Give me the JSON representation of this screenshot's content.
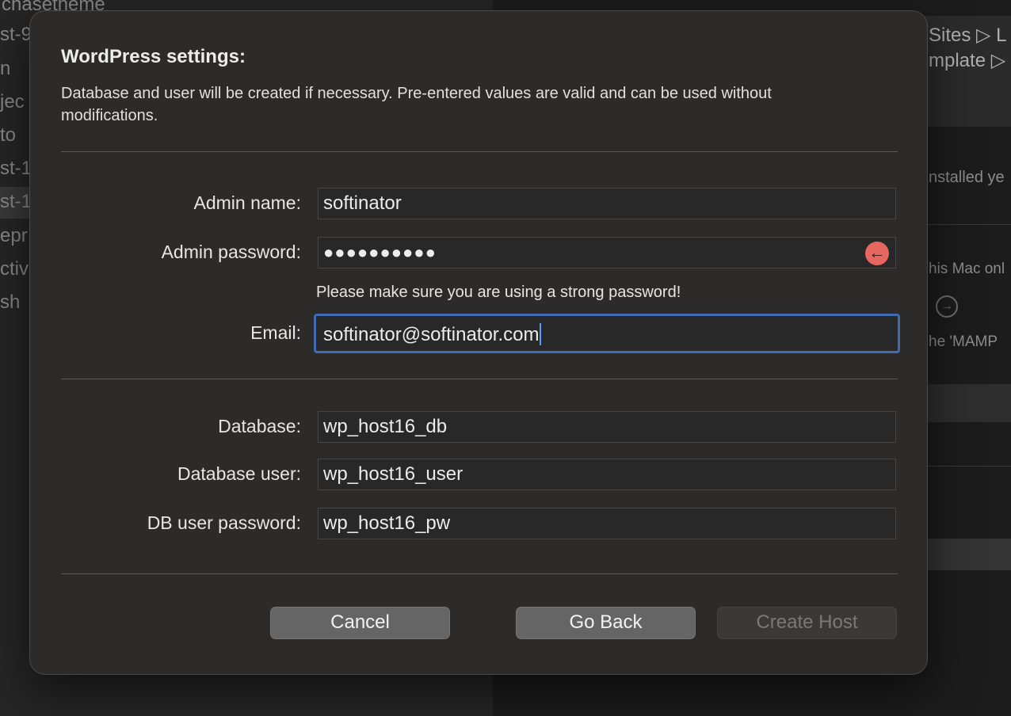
{
  "background": {
    "sidebar_items": [
      {
        "label": "chasetheme"
      },
      {
        "label": "st-9"
      },
      {
        "label": "n"
      },
      {
        "label": "jec"
      },
      {
        "label": "to"
      },
      {
        "label": "st-1"
      },
      {
        "label": "st-1"
      },
      {
        "label": "epr"
      },
      {
        "label": "ctiv"
      },
      {
        "label": "sh"
      }
    ],
    "breadcrumb_line1": "Sites ▷ L",
    "breadcrumb_line2": "mplate ▷",
    "status_text": "nstalled ye",
    "mac_text": "his Mac onl",
    "mamp_text": "he 'MAMP"
  },
  "sheet": {
    "title": "WordPress settings:",
    "description": "Database and user will be created if necessary. Pre-entered values are valid and can be used without modifications.",
    "admin_name": {
      "label": "Admin name:",
      "value": "softinator"
    },
    "admin_password": {
      "label": "Admin password:",
      "value": "●●●●●●●●●●",
      "reveal_icon": "arrow-left-circle-icon"
    },
    "password_hint": "Please make sure you are using a strong password!",
    "email": {
      "label": "Email:",
      "value": "softinator@softinator.com"
    },
    "database": {
      "label": "Database:",
      "value": "wp_host16_db"
    },
    "database_user": {
      "label": "Database user:",
      "value": "wp_host16_user"
    },
    "db_user_password": {
      "label": "DB user password:",
      "value": "wp_host16_pw"
    },
    "buttons": {
      "cancel": "Cancel",
      "go_back": "Go Back",
      "create_host": "Create Host"
    }
  },
  "colors": {
    "focus_ring": "#3e6bb4",
    "reveal_icon": "#e5675f",
    "sheet_bg": "#2c2b2a"
  }
}
